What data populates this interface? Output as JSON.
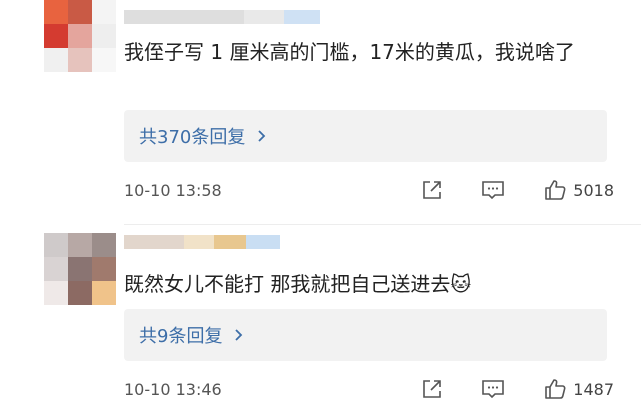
{
  "comments": [
    {
      "text": "我侄子写 1 厘米高的门槛，17米的黄瓜，我说啥了",
      "reply_label": "共370条回复",
      "timestamp": "10-10 13:58",
      "likes": "5018",
      "avatar_colors": [
        "#e8633f",
        "#c95a45",
        "#f4f4f4",
        "#d43b30",
        "#e4a59d",
        "#eeeeee",
        "#f0f0f0",
        "#e6c3bd",
        "#f7f7f7"
      ]
    },
    {
      "text": "既然女儿不能打 那我就把自己送进去🐱",
      "reply_label": "共9条回复",
      "timestamp": "10-10 13:46",
      "likes": "1487",
      "avatar_colors": [
        "#cfcaca",
        "#b7a8a5",
        "#9b8d8a",
        "#d9d3d3",
        "#8a7472",
        "#a07a6d",
        "#efe9e8",
        "#8c6a63",
        "#f0c38a"
      ]
    }
  ],
  "icons": {
    "share": "share-icon",
    "comment": "comment-icon",
    "like": "thumbs-up-icon",
    "reply_arrow": "chevron-right-icon"
  },
  "colors": {
    "reply_link": "#3d6ea8",
    "reply_bg": "#f2f2f2",
    "meta_text": "#555555",
    "icon": "#555555"
  }
}
